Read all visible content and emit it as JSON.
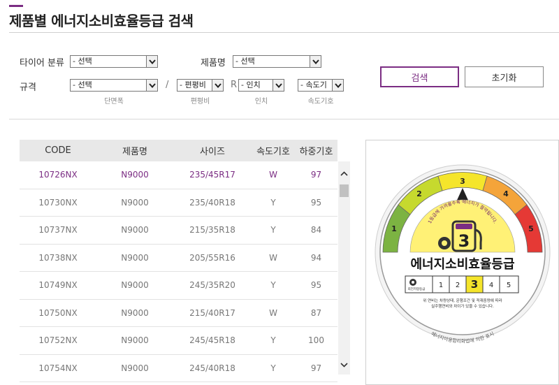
{
  "page": {
    "title": "제품별 에너지소비효율등급 검색"
  },
  "filters": {
    "tire_class_label": "타이어 분류",
    "tire_class_value": "- 선택",
    "product_name_label": "제품명",
    "product_name_value": "- 선택",
    "spec_label": "규격",
    "width_value": "- 선택",
    "width_caption": "단면폭",
    "slash": "/",
    "aspect_value": "- 편평비",
    "aspect_caption": "편평비",
    "r_mark": "R",
    "inch_value": "- 인치",
    "inch_caption": "인치",
    "speed_value": "- 속도기",
    "speed_caption": "속도기호"
  },
  "buttons": {
    "search": "검색",
    "reset": "초기화"
  },
  "table": {
    "headers": [
      "CODE",
      "제품명",
      "사이즈",
      "속도기호",
      "하중기호"
    ],
    "rows": [
      {
        "code": "10726NX",
        "name": "N9000",
        "size": "235/45R17",
        "speed": "W",
        "load": "97"
      },
      {
        "code": "10730NX",
        "name": "N9000",
        "size": "235/40R18",
        "speed": "Y",
        "load": "95"
      },
      {
        "code": "10737NX",
        "name": "N9000",
        "size": "215/35R18",
        "speed": "Y",
        "load": "84"
      },
      {
        "code": "10738NX",
        "name": "N9000",
        "size": "205/55R16",
        "speed": "W",
        "load": "94"
      },
      {
        "code": "10749NX",
        "name": "N9000",
        "size": "245/35R20",
        "speed": "Y",
        "load": "95"
      },
      {
        "code": "10750NX",
        "name": "N9000",
        "size": "215/40R17",
        "speed": "W",
        "load": "87"
      },
      {
        "code": "10752NX",
        "name": "N9000",
        "size": "245/45R18",
        "speed": "Y",
        "load": "100"
      },
      {
        "code": "10754NX",
        "name": "N9000",
        "size": "245/40R18",
        "speed": "Y",
        "load": "97"
      }
    ]
  },
  "energy_label": {
    "grade": "3",
    "grade_numbers": [
      "1",
      "2",
      "3",
      "4",
      "5"
    ],
    "title": "에너지소비효율등급",
    "arc_text": "1등급에 가까울수록 에너지가 절약됩니다.",
    "scale_prefix": "회전저항등급",
    "note_line1": "위 연비는 차량상태, 운행조건 및 적재중량에 따라",
    "note_line2": "실주행연비와 차이가 있을 수 있습니다.",
    "footer_arc": "에너지이용합리화법에 의한 표시",
    "colors": {
      "g1": "#7cb342",
      "g2": "#c6d92e",
      "g3": "#f5e52b",
      "g4": "#f4a43a",
      "g5": "#e53935",
      "accent": "#7b2d83"
    }
  }
}
